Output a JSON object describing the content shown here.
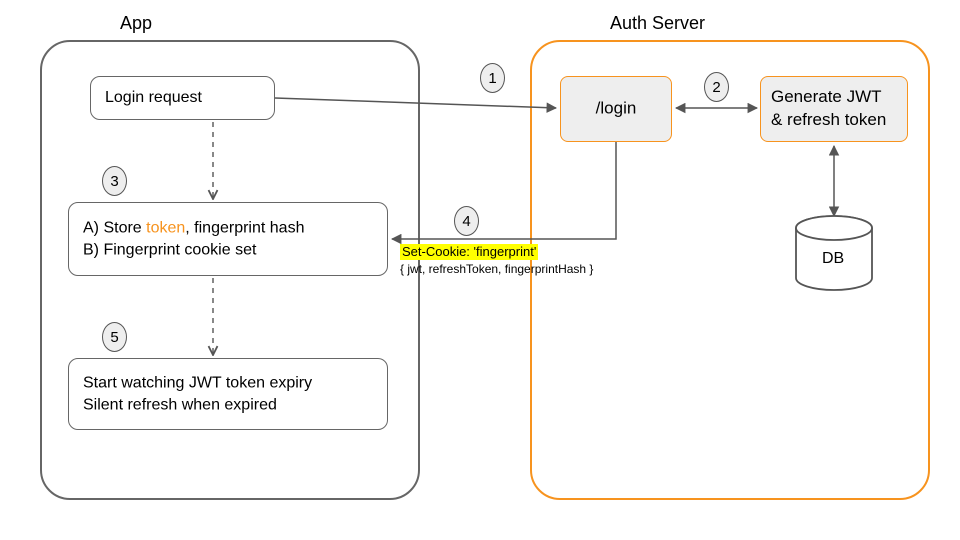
{
  "titles": {
    "app": "App",
    "auth": "Auth Server"
  },
  "nodes": {
    "login_request": "Login request",
    "login_endpoint": "/login",
    "generate_label_line1": "Generate JWT",
    "generate_label_line2": "& refresh token",
    "store_line1_a": "A) Store ",
    "store_token_word": "token",
    "store_line1_b": ", fingerprint hash",
    "store_line2": "B) Fingerprint cookie set",
    "watch_line1": "Start watching JWT token expiry",
    "watch_line2": "Silent refresh when expired",
    "db": "DB"
  },
  "steps": {
    "s1": "1",
    "s2": "2",
    "s3": "3",
    "s4": "4",
    "s5": "5"
  },
  "arrow4": {
    "cookie": "Set-Cookie: 'fingerprint'",
    "payload": "{ jwt, refreshToken, fingerprintHash }"
  }
}
